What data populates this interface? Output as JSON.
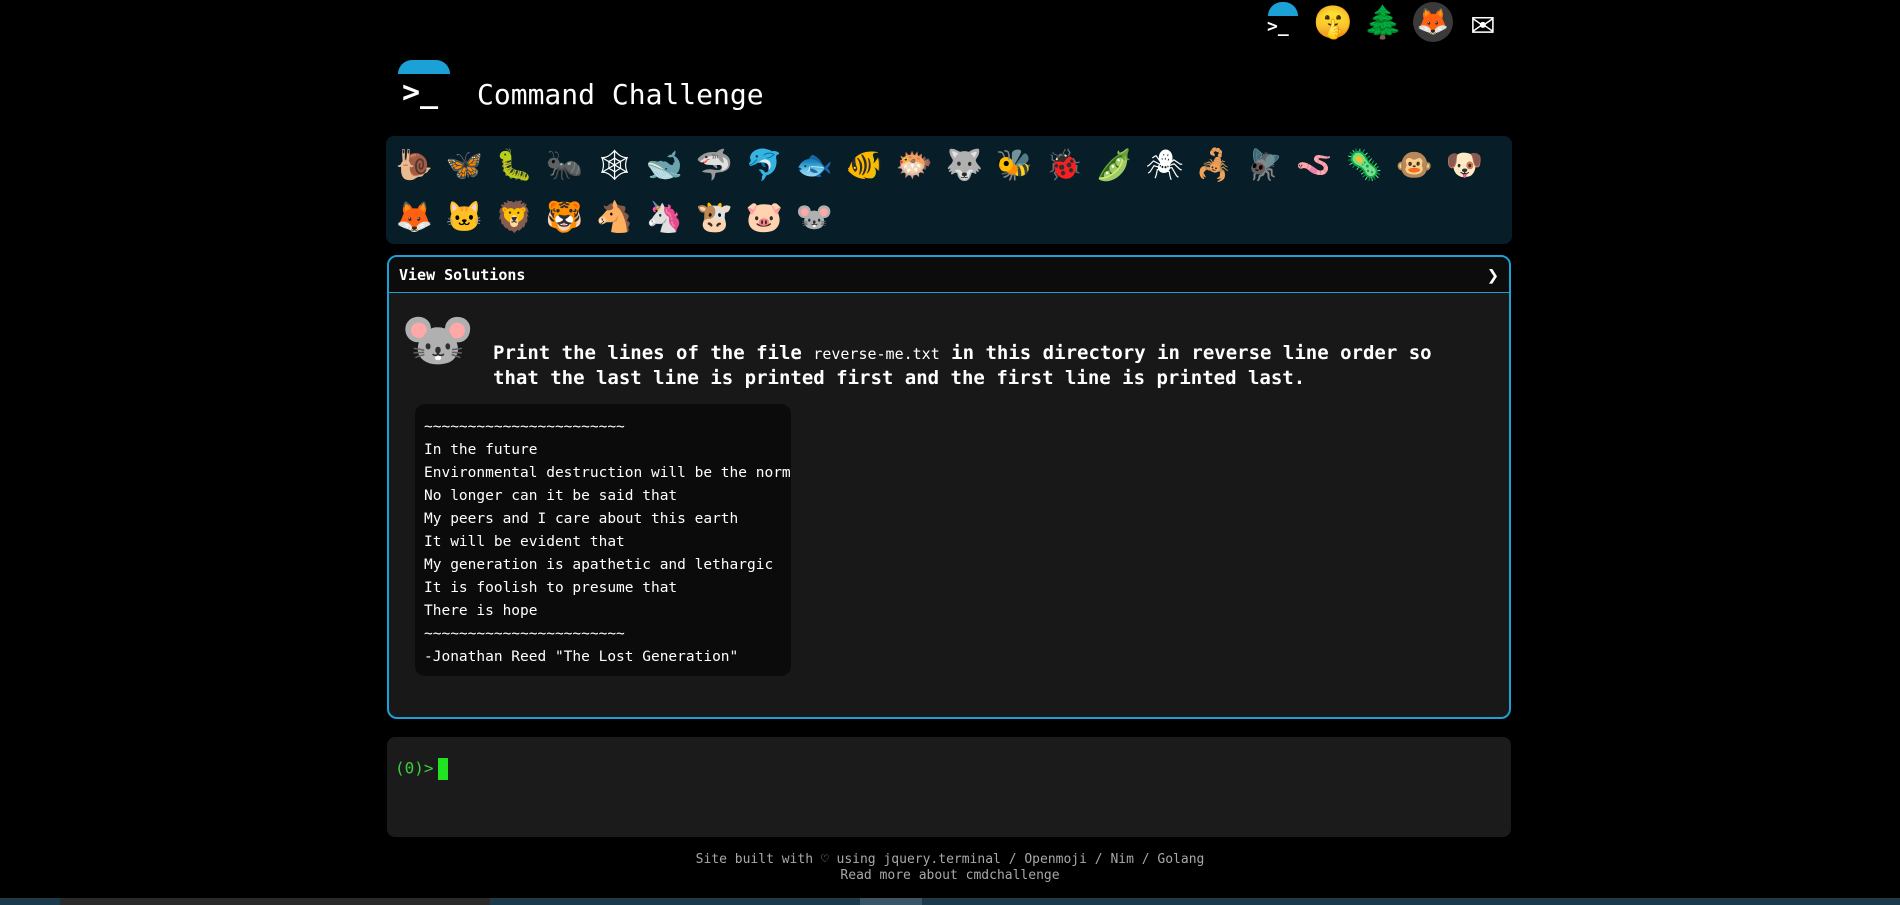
{
  "site": {
    "title": "Command Challenge",
    "logo_glyph": ">_"
  },
  "top_icons": [
    {
      "name": "terminal-icon",
      "glyph": ">_"
    },
    {
      "name": "shushing-face-icon",
      "glyph": "🤫"
    },
    {
      "name": "tree-icon",
      "glyph": "🌲"
    },
    {
      "name": "gitlab-fox-icon",
      "glyph": "🦊"
    },
    {
      "name": "mail-icon",
      "glyph": "✉"
    }
  ],
  "challenges": [
    {
      "name": "snail",
      "glyph": "🐌"
    },
    {
      "name": "butterfly",
      "glyph": "🦋"
    },
    {
      "name": "caterpillar",
      "glyph": "🐛"
    },
    {
      "name": "ant",
      "glyph": "🐜"
    },
    {
      "name": "web",
      "glyph": "🕸"
    },
    {
      "name": "whale",
      "glyph": "🐋"
    },
    {
      "name": "shark",
      "glyph": "🦈"
    },
    {
      "name": "dolphin",
      "glyph": "🐬"
    },
    {
      "name": "fish",
      "glyph": "🐟"
    },
    {
      "name": "tropical-fish",
      "glyph": "🐠"
    },
    {
      "name": "pufferfish",
      "glyph": "🐡"
    },
    {
      "name": "wolf",
      "glyph": "🐺"
    },
    {
      "name": "bee",
      "glyph": "🐝"
    },
    {
      "name": "ladybug",
      "glyph": "🐞"
    },
    {
      "name": "pea",
      "glyph": "🫛"
    },
    {
      "name": "spider",
      "glyph": "🕷"
    },
    {
      "name": "scorpion",
      "glyph": "🦂"
    },
    {
      "name": "fly",
      "glyph": "🪰"
    },
    {
      "name": "worm",
      "glyph": "🪱"
    },
    {
      "name": "microbe",
      "glyph": "🦠"
    },
    {
      "name": "monkey",
      "glyph": "🐵"
    },
    {
      "name": "dog",
      "glyph": "🐶"
    },
    {
      "name": "fox",
      "glyph": "🦊"
    },
    {
      "name": "cat",
      "glyph": "🐱"
    },
    {
      "name": "lion",
      "glyph": "🦁"
    },
    {
      "name": "tiger",
      "glyph": "🐯"
    },
    {
      "name": "horse",
      "glyph": "🐴"
    },
    {
      "name": "unicorn",
      "glyph": "🦄"
    },
    {
      "name": "cow",
      "glyph": "🐮"
    },
    {
      "name": "pig",
      "glyph": "🐷"
    },
    {
      "name": "mouse",
      "glyph": "🐭"
    }
  ],
  "panel": {
    "header_label": "View Solutions",
    "chevron": "❯",
    "task_animal": "🐭",
    "task_prefix": "Print the lines of the file ",
    "task_file": "reverse-me.txt",
    "task_suffix": " in this directory in reverse line order so that the last line is printed first and the first line is printed last.",
    "file_lines": [
      "~~~~~~~~~~~~~~~~~~~~~~~",
      "In the future",
      "Environmental destruction will be the norm",
      "No longer can it be said that",
      "My peers and I care about this earth",
      "It will be evident that",
      "My generation is apathetic and lethargic",
      "It is foolish to presume that",
      "There is hope",
      "~~~~~~~~~~~~~~~~~~~~~~~",
      "-Jonathan Reed \"The Lost Generation\""
    ]
  },
  "terminal": {
    "prompt": "(0)>"
  },
  "footer": {
    "line1": "Site built with ♡ using jquery.terminal / Openmoji / Nim / Golang",
    "line2": "Read more about cmdchallenge"
  }
}
